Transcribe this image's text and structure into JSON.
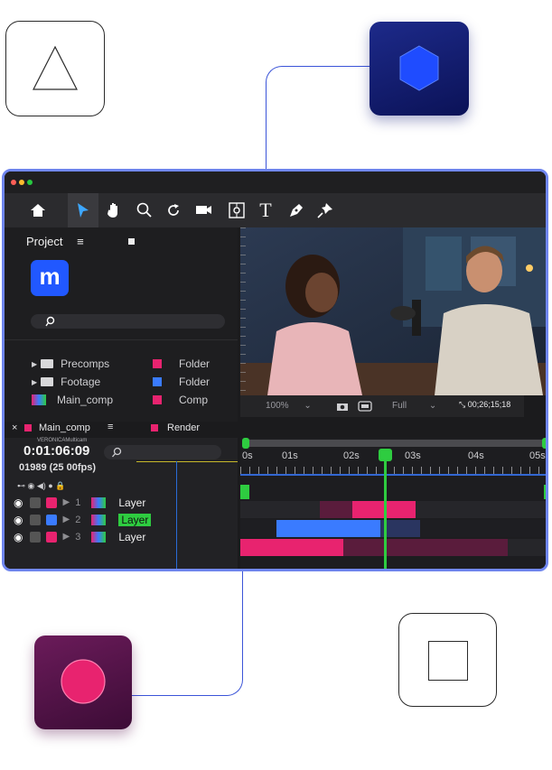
{
  "toolbar": {
    "home_icon": "home-icon",
    "select_icon": "arrow-select-icon",
    "hand_icon": "hand-icon",
    "zoom_icon": "magnifier-icon",
    "rotate_icon": "rotate-icon",
    "camera_icon": "camera-icon",
    "anchor_icon": "anchor-icon",
    "text_icon": "text-tool-icon",
    "pen_icon": "pen-icon",
    "pin_icon": "pin-icon"
  },
  "project": {
    "tab_label": "Project",
    "menu_glyph": "≡",
    "logo_letter": "m",
    "items": [
      {
        "name": "Precomps",
        "type": "Folder",
        "type_color": "#e8236f"
      },
      {
        "name": "Footage",
        "type": "Folder",
        "type_color": "#3a7bff"
      },
      {
        "name": "Main_comp",
        "type": "Comp",
        "type_color": "#e8236f"
      }
    ]
  },
  "viewer": {
    "zoom": "100%",
    "quality": "Full",
    "timecode": "00;26;15;18"
  },
  "comp": {
    "close": "×",
    "tab_label": "Main_comp",
    "menu_glyph": "≡",
    "render_label": "Render",
    "sub_label": "VERONICAMulticam",
    "current_time": "0:01:06:09",
    "frame_info": "01989 (25 00fps)"
  },
  "ruler": {
    "labels": [
      "0s",
      "01s",
      "02s",
      "03s",
      "04s",
      "05s"
    ]
  },
  "layers": [
    {
      "index": "1",
      "name": "Layer",
      "color": "#e8236f"
    },
    {
      "index": "2",
      "name": "Layer",
      "color": "#3a7bff"
    },
    {
      "index": "3",
      "name": "Layer",
      "color": "#e8236f"
    }
  ],
  "colors": {
    "accent_blue": "#2158ff",
    "accent_pink": "#e8236f",
    "playhead_green": "#2ecc40",
    "window_border": "#6f86f0"
  }
}
